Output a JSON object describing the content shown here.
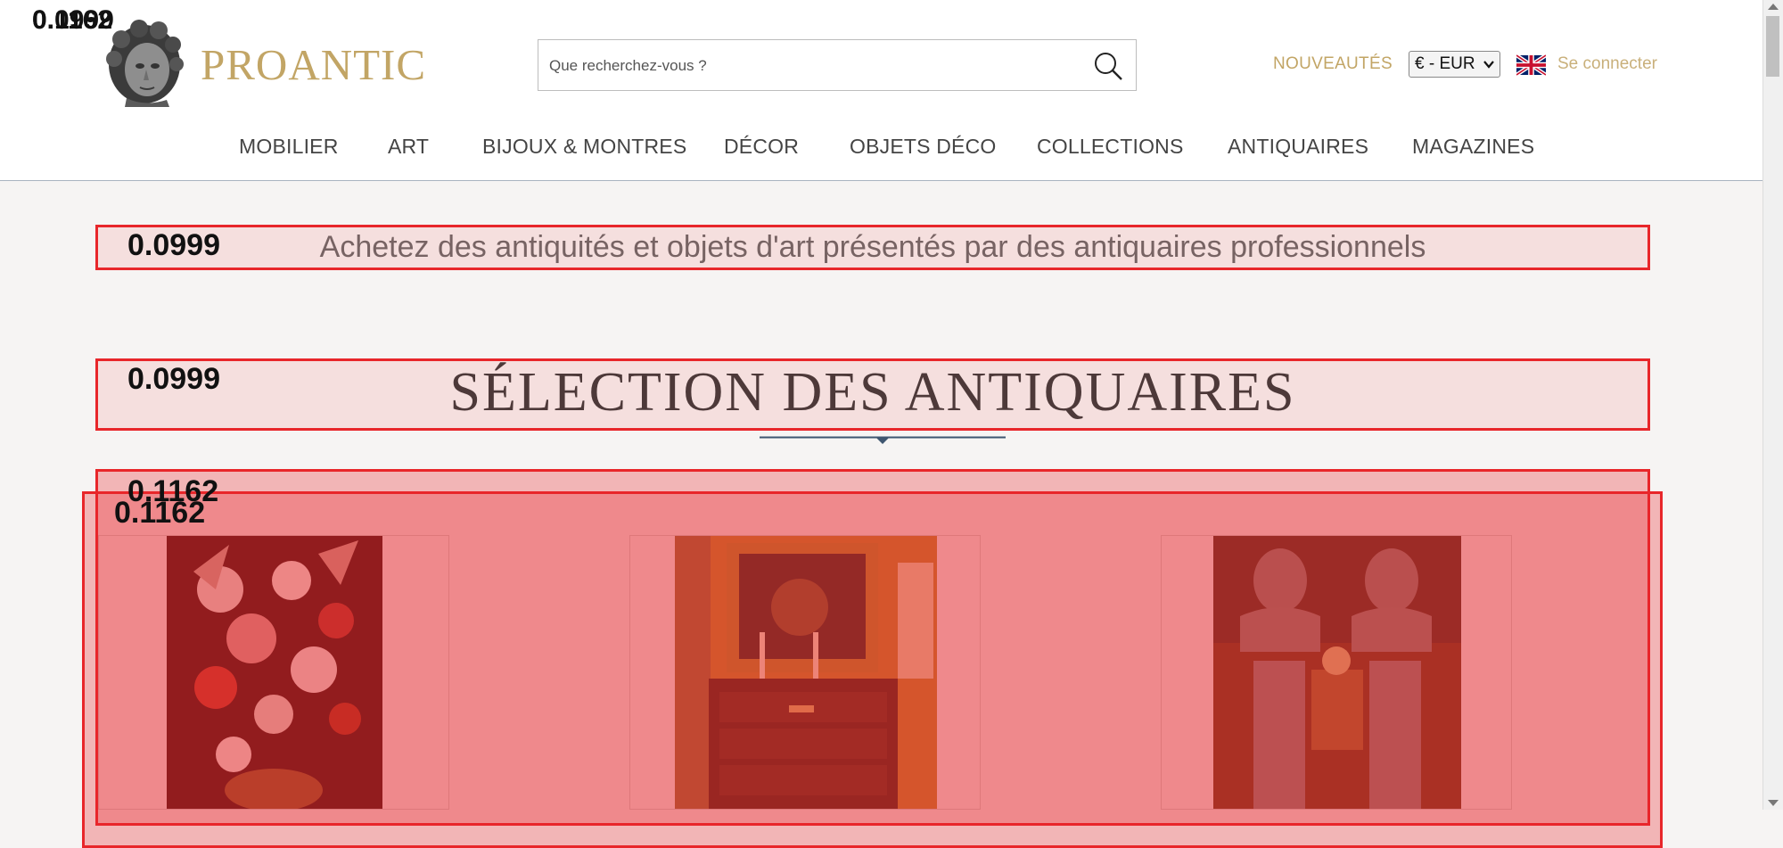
{
  "header": {
    "logo_text": "PROANTIC",
    "search_placeholder": "Que recherchez-vous ?",
    "nouveautes": "NOUVEAUTÉS",
    "currency": "€ - EUR",
    "login": "Se connecter",
    "colors": {
      "gold": "#c2a565",
      "nav_text": "#444444",
      "divider": "#a9b4c0"
    }
  },
  "nav": {
    "items": [
      "MOBILIER",
      "ART",
      "BIJOUX & MONTRES",
      "DÉCOR",
      "OBJETS DÉCO",
      "COLLECTIONS",
      "ANTIQUAIRES",
      "MAGAZINES"
    ]
  },
  "main": {
    "tagline": "Achetez des antiquités et objets d'art présentés par des antiquaires professionnels",
    "section_title": "SÉLECTION DES ANTIQUAIRES",
    "cards": [
      {
        "subject": "Bouquet de fleurs – tableau"
      },
      {
        "subject": "Salon avec commode et tableau"
      },
      {
        "subject": "Bustes sur colonnes"
      }
    ]
  },
  "overlays": {
    "corner_scores": [
      "0.1162",
      "0.0999"
    ],
    "tagline_score": "0.0999",
    "title_score": "0.0999",
    "grid_scores": [
      "0.1162",
      "0.1162"
    ],
    "color": "#e8262a"
  }
}
